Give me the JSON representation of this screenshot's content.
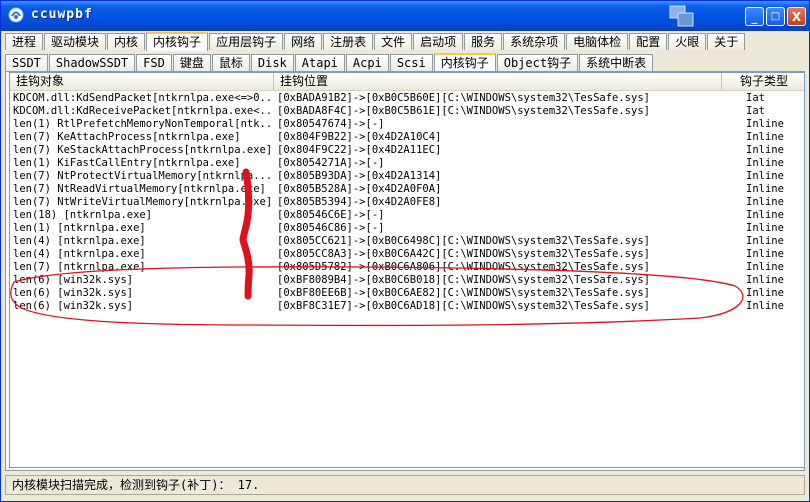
{
  "window": {
    "title": "ccuwpbf"
  },
  "title_buttons": {
    "minimize": "_",
    "maximize": "□",
    "close": "X"
  },
  "tabs_row1": [
    "进程",
    "驱动模块",
    "内核",
    "内核钩子",
    "应用层钩子",
    "网络",
    "注册表",
    "文件",
    "启动项",
    "服务",
    "系统杂项",
    "电脑体检",
    "配置",
    "火眼",
    "关于"
  ],
  "tabs_row1_active": "内核钩子",
  "tabs_row2": [
    "SSDT",
    "ShadowSSDT",
    "FSD",
    "键盘",
    "鼠标",
    "Disk",
    "Atapi",
    "Acpi",
    "Scsi",
    "内核钩子",
    "Object钩子",
    "系统中断表"
  ],
  "tabs_row2_active": "内核钩子",
  "table": {
    "columns": [
      "挂钩对象",
      "挂钩位置",
      "钩子类型"
    ],
    "rows": [
      [
        "KDCOM.dll:KdSendPacket[ntkrnlpa.exe<=>0...",
        "[0xBADA91B2]->[0xB0C5B60E][C:\\WINDOWS\\system32\\TesSafe.sys]",
        "Iat"
      ],
      [
        "KDCOM.dll:KdReceivePacket[ntkrnlpa.exe<...",
        "[0xBADA8F4C]->[0xB0C5B61E][C:\\WINDOWS\\system32\\TesSafe.sys]",
        "Iat"
      ],
      [
        "len(1) RtlPrefetchMemoryNonTemporal[ntk...",
        "[0x80547674]->[-]",
        "Inline"
      ],
      [
        "len(7) KeAttachProcess[ntkrnlpa.exe]",
        "[0x804F9B22]->[0x4D2A10C4]",
        "Inline"
      ],
      [
        "len(7) KeStackAttachProcess[ntkrnlpa.exe]",
        "[0x804F9C22]->[0x4D2A11EC]",
        "Inline"
      ],
      [
        "len(1) KiFastCallEntry[ntkrnlpa.exe]",
        "[0x8054271A]->[-]",
        "Inline"
      ],
      [
        "len(7) NtProtectVirtualMemory[ntkrnlpa...",
        "[0x805B93DA]->[0x4D2A1314]",
        "Inline"
      ],
      [
        "len(7) NtReadVirtualMemory[ntkrnlpa.exe]",
        "[0x805B528A]->[0x4D2A0F0A]",
        "Inline"
      ],
      [
        "len(7) NtWriteVirtualMemory[ntkrnlpa.exe]",
        "[0x805B5394]->[0x4D2A0FE8]",
        "Inline"
      ],
      [
        "len(18) [ntkrnlpa.exe]",
        "[0x80546C6E]->[-]",
        "Inline"
      ],
      [
        "len(1) [ntkrnlpa.exe]",
        "[0x80546C86]->[-]",
        "Inline"
      ],
      [
        "len(4) [ntkrnlpa.exe]",
        "[0x805CC621]->[0xB0C6498C][C:\\WINDOWS\\system32\\TesSafe.sys]",
        "Inline"
      ],
      [
        "len(4) [ntkrnlpa.exe]",
        "[0x805CC8A3]->[0xB0C6A42C][C:\\WINDOWS\\system32\\TesSafe.sys]",
        "Inline"
      ],
      [
        "len(7) [ntkrnlpa.exe]",
        "[0x805D5782]->[0xB0C6A806][C:\\WINDOWS\\system32\\TesSafe.sys]",
        "Inline"
      ],
      [
        "len(6) [win32k.sys]",
        "[0xBF8089B4]->[0xB0C6B018][C:\\WINDOWS\\system32\\TesSafe.sys]",
        "Inline"
      ],
      [
        "len(6) [win32k.sys]",
        "[0xBF80EE6B]->[0xB0C6AE82][C:\\WINDOWS\\system32\\TesSafe.sys]",
        "Inline"
      ],
      [
        "len(6) [win32k.sys]",
        "[0xBF8C31E7]->[0xB0C6AD18][C:\\WINDOWS\\system32\\TesSafe.sys]",
        "Inline"
      ]
    ]
  },
  "status": {
    "text": "内核模块扫描完成，检测到钩子(补丁)： 17."
  },
  "annotations": {
    "color": "#e0101c"
  }
}
